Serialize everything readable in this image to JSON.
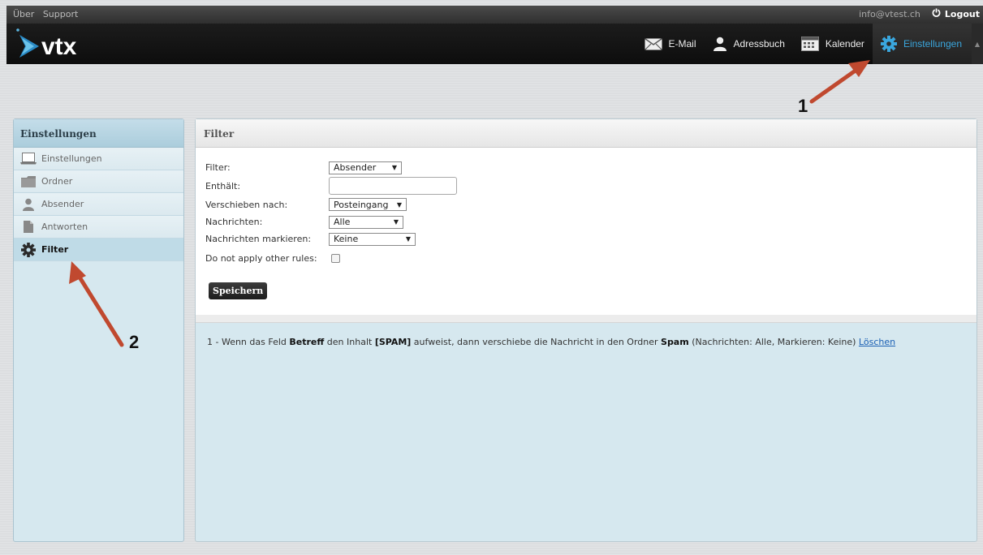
{
  "topbar": {
    "links": [
      "Über",
      "Support"
    ],
    "email": "info@vtest.ch",
    "logout_label": "Logout"
  },
  "header": {
    "logo_text": "vtx",
    "nav": [
      {
        "label": "E-Mail",
        "icon": "envelope-icon"
      },
      {
        "label": "Adressbuch",
        "icon": "person-icon"
      },
      {
        "label": "Kalender",
        "icon": "calendar-icon"
      },
      {
        "label": "Einstellungen",
        "icon": "gear-icon",
        "active": true
      }
    ]
  },
  "sidebar": {
    "title": "Einstellungen",
    "items": [
      {
        "label": "Einstellungen",
        "icon": "laptop-icon"
      },
      {
        "label": "Ordner",
        "icon": "folder-icon"
      },
      {
        "label": "Absender",
        "icon": "person-icon"
      },
      {
        "label": "Antworten",
        "icon": "document-icon"
      },
      {
        "label": "Filter",
        "icon": "gear-icon",
        "active": true
      }
    ]
  },
  "panel": {
    "title": "Filter",
    "form": {
      "filter_label": "Filter:",
      "filter_value": "Absender",
      "contains_label": "Enthält:",
      "contains_value": "",
      "move_label": "Verschieben nach:",
      "move_value": "Posteingang",
      "messages_label": "Nachrichten:",
      "messages_value": "Alle",
      "mark_label": "Nachrichten markieren:",
      "mark_value": "Keine",
      "no_other_rules_label": "Do not apply other rules:",
      "no_other_rules_checked": false,
      "save_label": "Speichern"
    },
    "rules": [
      {
        "prefix": "1 - Wenn das Feld ",
        "field": "Betreff",
        "mid1": " den Inhalt ",
        "content": "[SPAM]",
        "mid2": " aufweist, dann verschiebe die Nachricht in den Ordner ",
        "folder": "Spam",
        "suffix": " (Nachrichten: Alle, Markieren: Keine) ",
        "delete_label": "Löschen"
      }
    ]
  },
  "annotations": {
    "labels": [
      "1",
      "2"
    ],
    "arrow_color": "#c0492f"
  }
}
